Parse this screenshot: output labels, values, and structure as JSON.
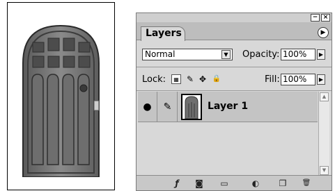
{
  "panel": {
    "tab_label": "Layers",
    "blend_mode": "Normal",
    "opacity_label": "Opacity:",
    "opacity_value": "100%",
    "lock_label": "Lock:",
    "fill_label": "Fill:",
    "fill_value": "100%"
  },
  "layers": [
    {
      "name": "Layer 1"
    }
  ],
  "window_buttons": {
    "minimize": "−",
    "close": "×"
  },
  "glyphs": {
    "dropdown_arrow": "▼",
    "stepper_arrow": "▶",
    "menu_arrow": "▶",
    "scroll_up": "▲",
    "scroll_down": "▼",
    "eye": "●",
    "brush": "✎",
    "lock_move": "✥",
    "lock_all": "🔒",
    "layer_style": "ƒ",
    "mask": "◙",
    "new_set": "▭",
    "adjustment": "◐",
    "new_layer": "❐",
    "trash": "🗑"
  },
  "colors": {
    "panel_bg": "#d8d8d8",
    "tab_strip_bg": "#bdbdbd",
    "selected_row_bg": "#c4c4c4",
    "door_wood": "#6f6f6f"
  }
}
